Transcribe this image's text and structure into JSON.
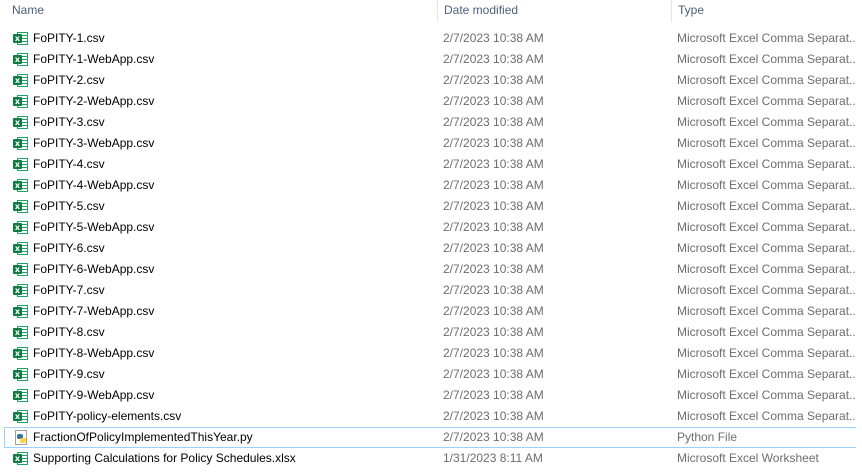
{
  "columns": {
    "name": "Name",
    "date": "Date modified",
    "type": "Type"
  },
  "files": [
    {
      "name": "FoPITY-1.csv",
      "date": "2/7/2023 10:38 AM",
      "type": "Microsoft Excel Comma Separat...",
      "icon": "excel-icon"
    },
    {
      "name": "FoPITY-1-WebApp.csv",
      "date": "2/7/2023 10:38 AM",
      "type": "Microsoft Excel Comma Separat...",
      "icon": "excel-icon"
    },
    {
      "name": "FoPITY-2.csv",
      "date": "2/7/2023 10:38 AM",
      "type": "Microsoft Excel Comma Separat...",
      "icon": "excel-icon"
    },
    {
      "name": "FoPITY-2-WebApp.csv",
      "date": "2/7/2023 10:38 AM",
      "type": "Microsoft Excel Comma Separat...",
      "icon": "excel-icon"
    },
    {
      "name": "FoPITY-3.csv",
      "date": "2/7/2023 10:38 AM",
      "type": "Microsoft Excel Comma Separat...",
      "icon": "excel-icon"
    },
    {
      "name": "FoPITY-3-WebApp.csv",
      "date": "2/7/2023 10:38 AM",
      "type": "Microsoft Excel Comma Separat...",
      "icon": "excel-icon"
    },
    {
      "name": "FoPITY-4.csv",
      "date": "2/7/2023 10:38 AM",
      "type": "Microsoft Excel Comma Separat...",
      "icon": "excel-icon"
    },
    {
      "name": "FoPITY-4-WebApp.csv",
      "date": "2/7/2023 10:38 AM",
      "type": "Microsoft Excel Comma Separat...",
      "icon": "excel-icon"
    },
    {
      "name": "FoPITY-5.csv",
      "date": "2/7/2023 10:38 AM",
      "type": "Microsoft Excel Comma Separat...",
      "icon": "excel-icon"
    },
    {
      "name": "FoPITY-5-WebApp.csv",
      "date": "2/7/2023 10:38 AM",
      "type": "Microsoft Excel Comma Separat...",
      "icon": "excel-icon"
    },
    {
      "name": "FoPITY-6.csv",
      "date": "2/7/2023 10:38 AM",
      "type": "Microsoft Excel Comma Separat...",
      "icon": "excel-icon"
    },
    {
      "name": "FoPITY-6-WebApp.csv",
      "date": "2/7/2023 10:38 AM",
      "type": "Microsoft Excel Comma Separat...",
      "icon": "excel-icon"
    },
    {
      "name": "FoPITY-7.csv",
      "date": "2/7/2023 10:38 AM",
      "type": "Microsoft Excel Comma Separat...",
      "icon": "excel-icon"
    },
    {
      "name": "FoPITY-7-WebApp.csv",
      "date": "2/7/2023 10:38 AM",
      "type": "Microsoft Excel Comma Separat...",
      "icon": "excel-icon"
    },
    {
      "name": "FoPITY-8.csv",
      "date": "2/7/2023 10:38 AM",
      "type": "Microsoft Excel Comma Separat...",
      "icon": "excel-icon"
    },
    {
      "name": "FoPITY-8-WebApp.csv",
      "date": "2/7/2023 10:38 AM",
      "type": "Microsoft Excel Comma Separat...",
      "icon": "excel-icon"
    },
    {
      "name": "FoPITY-9.csv",
      "date": "2/7/2023 10:38 AM",
      "type": "Microsoft Excel Comma Separat...",
      "icon": "excel-icon"
    },
    {
      "name": "FoPITY-9-WebApp.csv",
      "date": "2/7/2023 10:38 AM",
      "type": "Microsoft Excel Comma Separat...",
      "icon": "excel-icon"
    },
    {
      "name": "FoPITY-policy-elements.csv",
      "date": "2/7/2023 10:38 AM",
      "type": "Microsoft Excel Comma Separat...",
      "icon": "excel-icon"
    },
    {
      "name": "FractionOfPolicyImplementedThisYear.py",
      "date": "2/7/2023 10:38 AM",
      "type": "Python File",
      "icon": "python-file-icon",
      "focused": true
    },
    {
      "name": "Supporting Calculations for Policy Schedules.xlsx",
      "date": "1/31/2023 8:11 AM",
      "type": "Microsoft Excel Worksheet",
      "icon": "excel-icon"
    }
  ],
  "colors": {
    "header_text": "#4c607a",
    "secondary_text": "#6d6d6d",
    "focus_border": "#99d1ff",
    "excel_green": "#107c41"
  }
}
